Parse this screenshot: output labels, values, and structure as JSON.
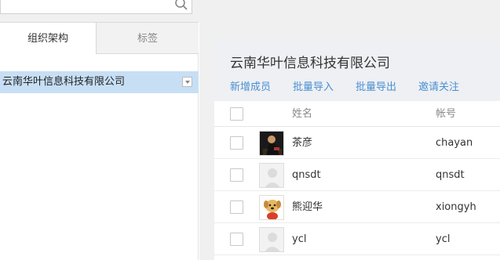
{
  "search": {
    "placeholder": ""
  },
  "tabs": [
    {
      "label": "组织架构"
    },
    {
      "label": "标签"
    }
  ],
  "tree": {
    "root_label": "云南华叶信息科技有限公司"
  },
  "panel": {
    "title": "云南华叶信息科技有限公司",
    "actions": [
      {
        "label": "新增成员"
      },
      {
        "label": "批量导入"
      },
      {
        "label": "批量导出"
      },
      {
        "label": "邀请关注"
      }
    ]
  },
  "table": {
    "columns": {
      "name": "姓名",
      "account": "帐号"
    },
    "rows": [
      {
        "name": "茶彦",
        "account": "chayan",
        "avatar": "custom-photo"
      },
      {
        "name": "qnsdt",
        "account": "qnsdt",
        "avatar": "default-person"
      },
      {
        "name": "熊迎华",
        "account": "xiongyh",
        "avatar": "cartoon-dog"
      },
      {
        "name": "ycl",
        "account": "ycl",
        "avatar": "default-person"
      }
    ]
  },
  "colors": {
    "accent": "#4a8fd4",
    "selected_row": "#c7dff5",
    "panel_header": "#eef0f3",
    "page_background": "#f0f0f0"
  }
}
